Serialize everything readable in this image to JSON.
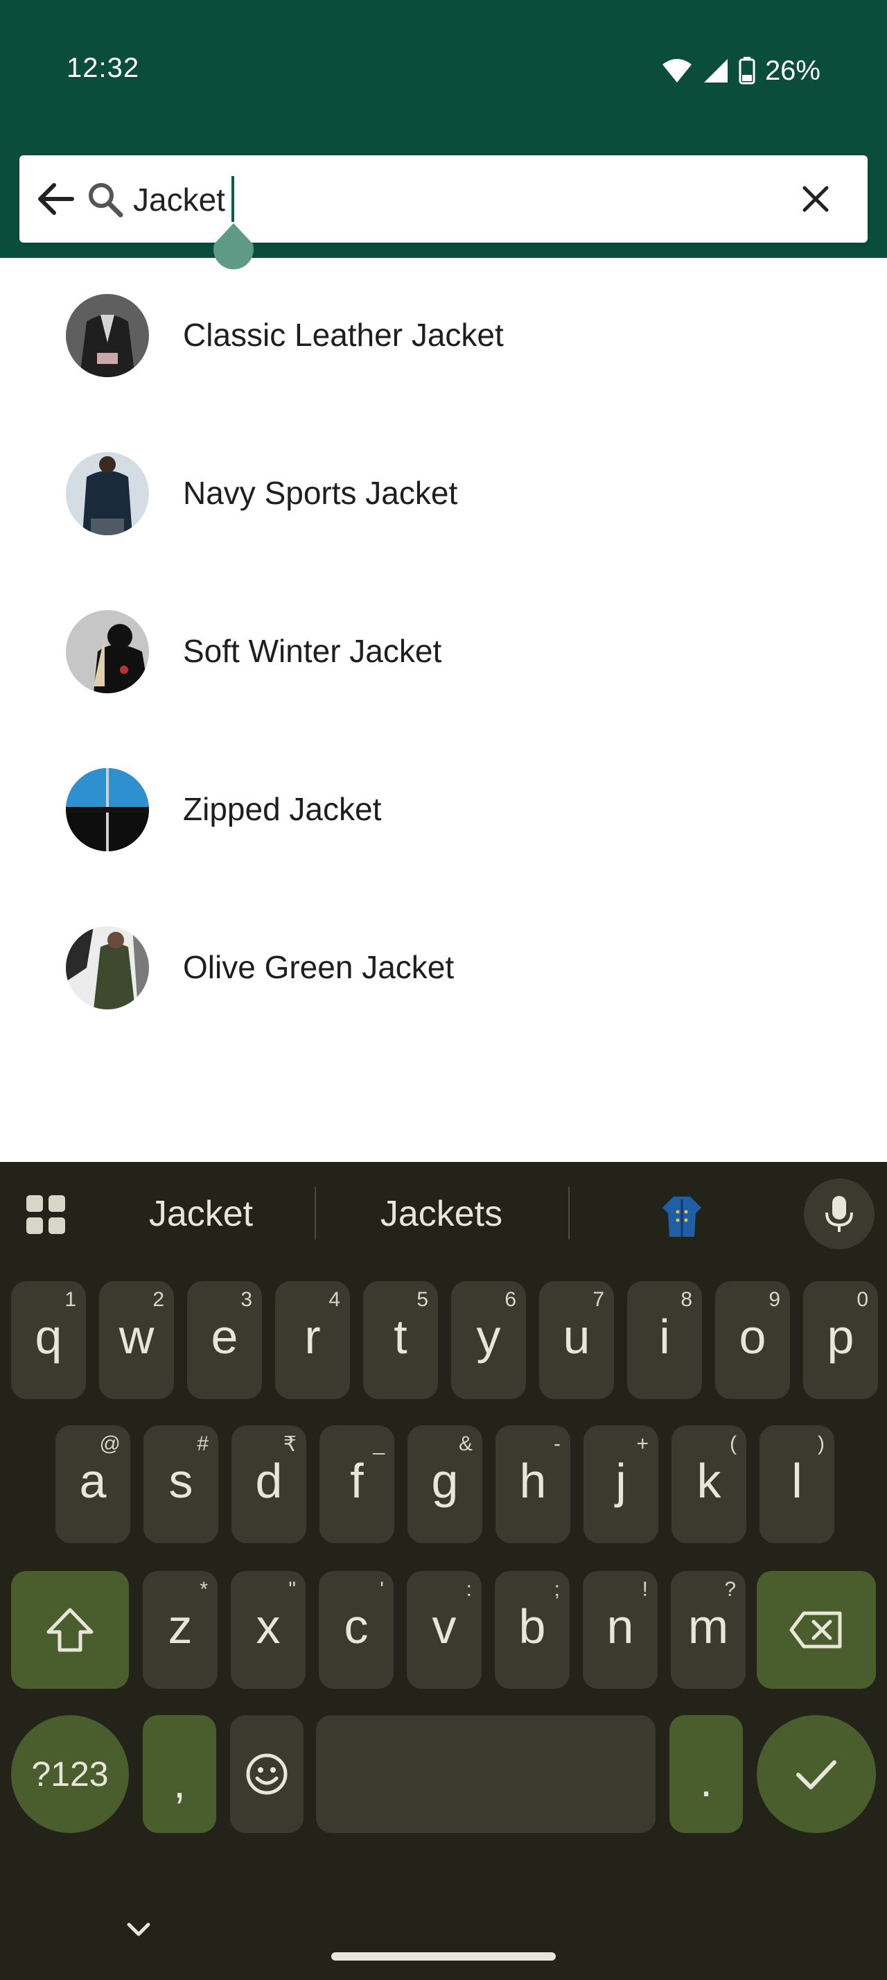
{
  "status_bar": {
    "time": "12:32",
    "battery": "26%"
  },
  "search": {
    "query": "Jacket"
  },
  "results": [
    {
      "label": "Classic Leather Jacket",
      "thumb_colors": [
        "#6b6b6b",
        "#2a2a2a",
        "#c9c9c9"
      ]
    },
    {
      "label": "Navy Sports Jacket",
      "thumb_colors": [
        "#d7e0e6",
        "#1d2a3a",
        "#8aa0b3"
      ]
    },
    {
      "label": "Soft Winter Jacket",
      "thumb_colors": [
        "#c8c8c8",
        "#111111",
        "#d9c7a8"
      ]
    },
    {
      "label": "Zipped Jacket",
      "thumb_colors": [
        "#2f8fcf",
        "#0c0c0c",
        "#6fb7e6"
      ]
    },
    {
      "label": "Olive Green Jacket",
      "thumb_colors": [
        "#e9e9e9",
        "#3f4a2e",
        "#7a6a5a"
      ]
    }
  ],
  "keyboard": {
    "suggestions": [
      "Jacket",
      "Jackets"
    ],
    "row1": [
      {
        "ch": "q",
        "sup": "1"
      },
      {
        "ch": "w",
        "sup": "2"
      },
      {
        "ch": "e",
        "sup": "3"
      },
      {
        "ch": "r",
        "sup": "4"
      },
      {
        "ch": "t",
        "sup": "5"
      },
      {
        "ch": "y",
        "sup": "6"
      },
      {
        "ch": "u",
        "sup": "7"
      },
      {
        "ch": "i",
        "sup": "8"
      },
      {
        "ch": "o",
        "sup": "9"
      },
      {
        "ch": "p",
        "sup": "0"
      }
    ],
    "row2": [
      {
        "ch": "a",
        "sup": "@"
      },
      {
        "ch": "s",
        "sup": "#"
      },
      {
        "ch": "d",
        "sup": "₹"
      },
      {
        "ch": "f",
        "sup": "_"
      },
      {
        "ch": "g",
        "sup": "&"
      },
      {
        "ch": "h",
        "sup": "-"
      },
      {
        "ch": "j",
        "sup": "+"
      },
      {
        "ch": "k",
        "sup": "("
      },
      {
        "ch": "l",
        "sup": ")"
      }
    ],
    "row3": [
      {
        "ch": "z",
        "sup": "*"
      },
      {
        "ch": "x",
        "sup": "\""
      },
      {
        "ch": "c",
        "sup": "'"
      },
      {
        "ch": "v",
        "sup": ":"
      },
      {
        "ch": "b",
        "sup": ";"
      },
      {
        "ch": "n",
        "sup": "!"
      },
      {
        "ch": "m",
        "sup": "?"
      }
    ],
    "symbols_label": "?123",
    "comma": ",",
    "period": "."
  },
  "colors": {
    "header": "#0b4d3b",
    "keyboard_bg": "#23231a",
    "key": "#3b3a2f",
    "key_accent": "#4a5d2d"
  },
  "icons": [
    "back-arrow-icon",
    "search-icon",
    "close-icon",
    "grid-icon",
    "coat-emoji-icon",
    "microphone-icon",
    "shift-icon",
    "backspace-icon",
    "emoji-icon",
    "checkmark-icon",
    "chevron-down-icon"
  ]
}
